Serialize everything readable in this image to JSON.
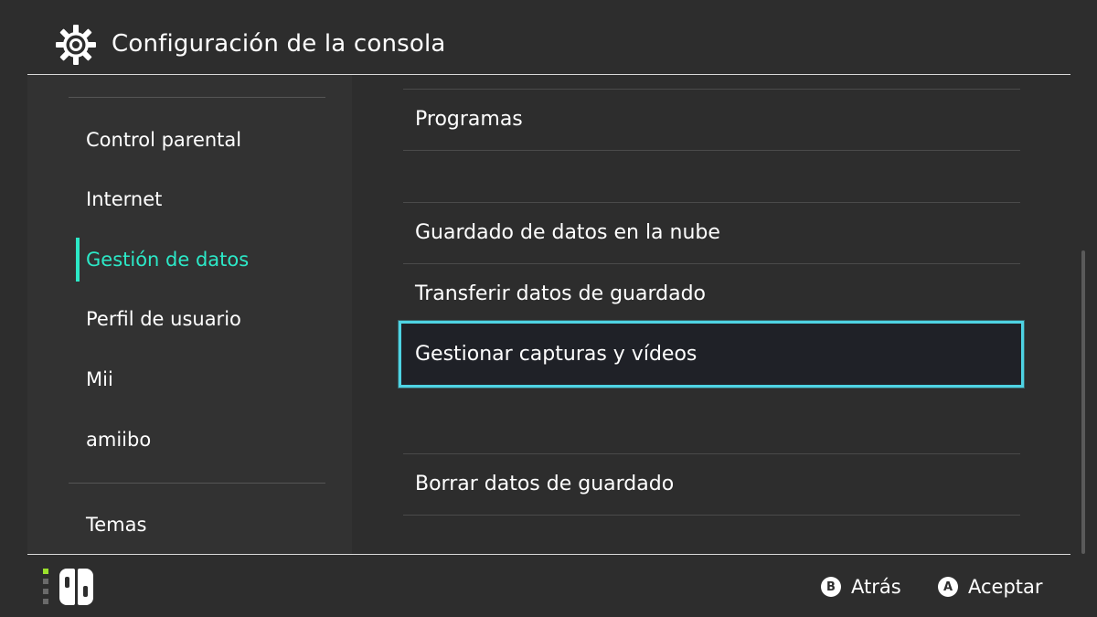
{
  "header": {
    "title": "Configuración de la consola",
    "icon": "gear-icon"
  },
  "sidebar": {
    "items": [
      {
        "label": "Control parental",
        "active": false
      },
      {
        "label": "Internet",
        "active": false
      },
      {
        "label": "Gestión de datos",
        "active": true
      },
      {
        "label": "Perfil de usuario",
        "active": false
      },
      {
        "label": "Mii",
        "active": false
      },
      {
        "label": "amiibo",
        "active": false
      },
      {
        "label": "Temas",
        "active": false
      }
    ]
  },
  "main": {
    "items": [
      {
        "label": "Programas",
        "selected": false
      },
      {
        "label": "Guardado de datos en la nube",
        "selected": false
      },
      {
        "label": "Transferir datos de guardado",
        "selected": false
      },
      {
        "label": "Gestionar capturas y vídeos",
        "selected": true
      },
      {
        "label": "Borrar datos de guardado",
        "selected": false
      }
    ]
  },
  "footer": {
    "back": {
      "key": "B",
      "label": "Atrás"
    },
    "accept": {
      "key": "A",
      "label": "Aceptar"
    }
  },
  "colors": {
    "background": "#2d2d2d",
    "sidebar": "#323232",
    "accent": "#2ce8c7",
    "selection_border": "#4ed3e3",
    "player_led": "#9be02c"
  }
}
